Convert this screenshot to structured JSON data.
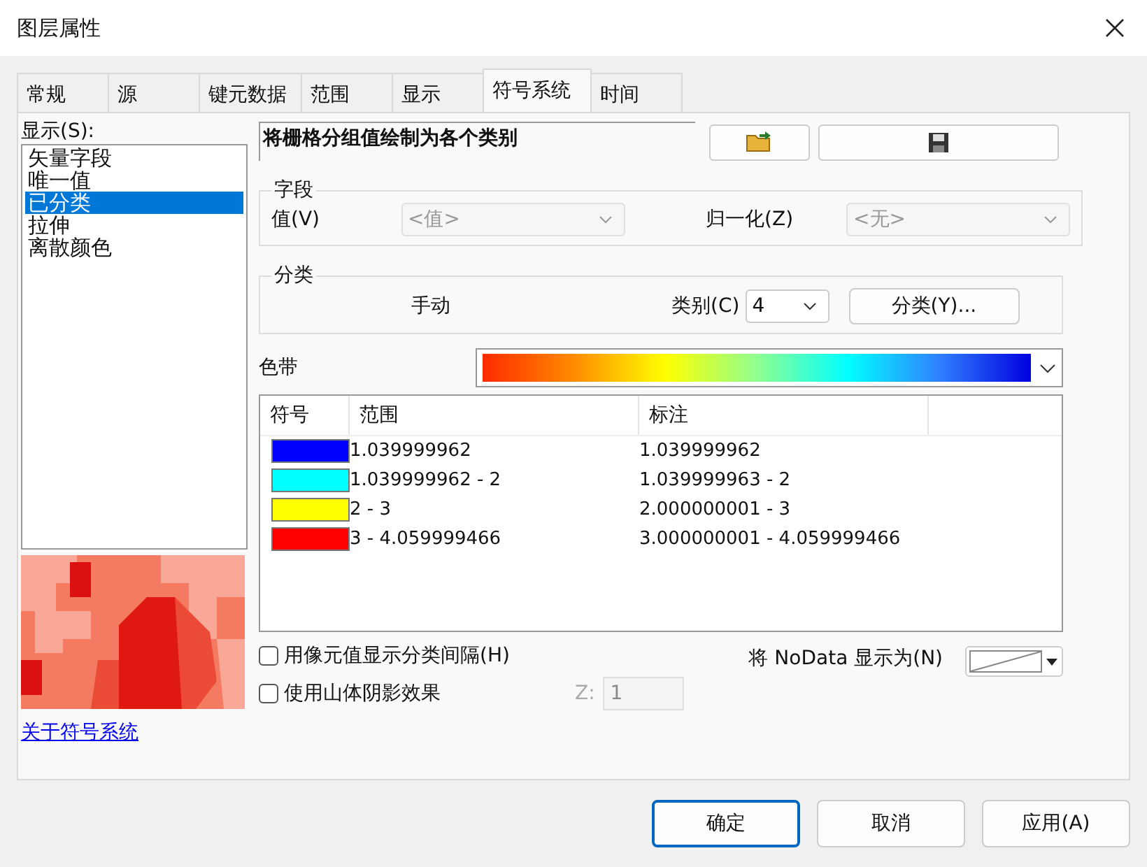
{
  "window": {
    "title": "图层属性"
  },
  "tabs": [
    {
      "label": "常规",
      "selected": false
    },
    {
      "label": "源",
      "selected": false
    },
    {
      "label": "键元数据",
      "selected": false
    },
    {
      "label": "范围",
      "selected": false
    },
    {
      "label": "显示",
      "selected": false
    },
    {
      "label": "符号系统",
      "selected": true
    },
    {
      "label": "时间",
      "selected": false
    }
  ],
  "show_label": "显示(S):",
  "renderers": [
    {
      "label": "矢量字段",
      "selected": false
    },
    {
      "label": "唯一值",
      "selected": false
    },
    {
      "label": "已分类",
      "selected": true
    },
    {
      "label": "拉伸",
      "selected": false
    },
    {
      "label": "离散颜色",
      "selected": false
    }
  ],
  "about_link": "关于符号系统",
  "description": "将栅格分组值绘制为各个类别",
  "fields": {
    "title": "字段",
    "value_label": "值(V)",
    "value": "<值>",
    "value_disabled": true,
    "normalize_label": "归一化(Z)",
    "normalize": "<无>",
    "normalize_disabled": true
  },
  "classification": {
    "title": "分类",
    "method": "手动",
    "classes_label": "类别(C)",
    "classes": "4",
    "classify_button": "分类(Y)..."
  },
  "color_ramp_label": "色带",
  "table": {
    "columns": [
      "符号",
      "范围",
      "标注"
    ],
    "rows": [
      {
        "color": "#0000ff",
        "range": "1.039999962",
        "label": "1.039999962"
      },
      {
        "color": "#00ffff",
        "range": "1.039999962 - 2",
        "label": "1.039999963 - 2"
      },
      {
        "color": "#ffff00",
        "range": "2 - 3",
        "label": "2.000000001 - 3"
      },
      {
        "color": "#ff0000",
        "range": "3 - 4.059999466",
        "label": "3.000000001 - 4.059999466"
      }
    ]
  },
  "options": [
    {
      "label": "用像元值显示分类间隔(H)",
      "checked": false
    },
    {
      "label": "使用山体阴影效果",
      "checked": false
    }
  ],
  "z": {
    "label": "Z:",
    "value": "1",
    "disabled": true
  },
  "nodata_label": "将 NoData 显示为(N)",
  "buttons": [
    {
      "label": "确定",
      "default": true
    },
    {
      "label": "取消",
      "default": false
    },
    {
      "label": "应用(A)",
      "default": false
    }
  ]
}
